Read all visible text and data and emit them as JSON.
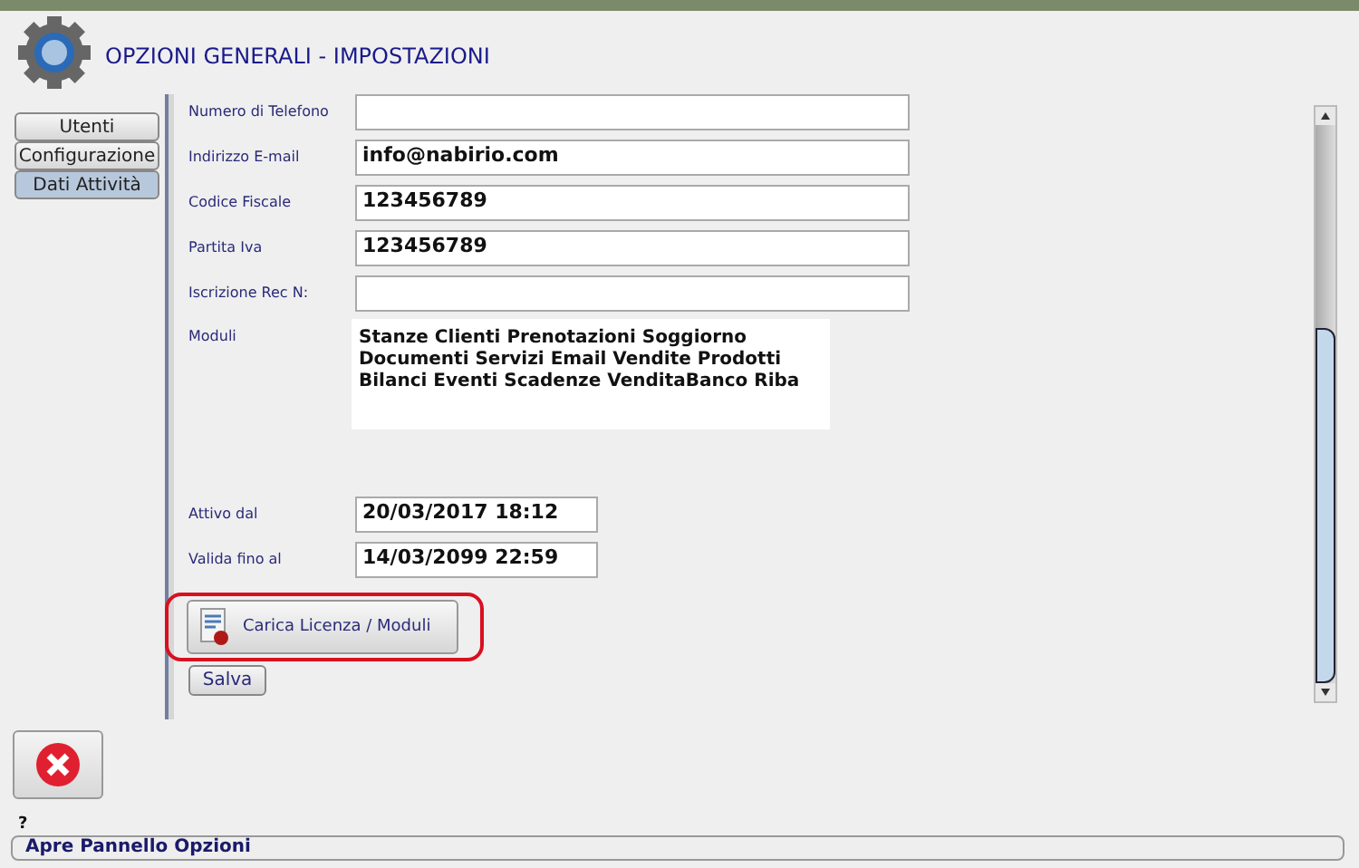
{
  "window": {
    "title": "OPZIONI GENERALI - IMPOSTAZIONI"
  },
  "tabs": [
    {
      "label": "Utenti",
      "selected": false
    },
    {
      "label": "Configurazione",
      "selected": false
    },
    {
      "label": "Dati Attività",
      "selected": true
    }
  ],
  "form": {
    "fields": [
      {
        "label": "Numero di Telefono",
        "kind": "input"
      },
      {
        "label": "Indirizzo E-mail",
        "value": "info@nabirio.com",
        "kind": "input"
      },
      {
        "label": "Codice Fiscale",
        "value": "123456789",
        "kind": "input"
      },
      {
        "label": "Partita Iva",
        "value": "123456789",
        "kind": "input"
      },
      {
        "label": "Iscrizione Rec N:",
        "kind": "input"
      },
      {
        "label": "Moduli",
        "value": "Stanze Clienti Prenotazioni Soggiorno Documenti Servizi Email Vendite Prodotti Bilanci Eventi Scadenze VenditaBanco Riba",
        "kind": "area"
      },
      {
        "label": "Attivo dal",
        "value": "20/03/2017 18:12",
        "kind": "short"
      },
      {
        "label": "Valida fino al",
        "value": "14/03/2099 22:59",
        "kind": "short"
      }
    ],
    "license_button": {
      "label": "Carica Licenza / Moduli",
      "highlighted": true
    },
    "save_button": {
      "label": "Salva"
    }
  },
  "help_mark": "?",
  "status_bar": "Apre Pannello Opzioni"
}
